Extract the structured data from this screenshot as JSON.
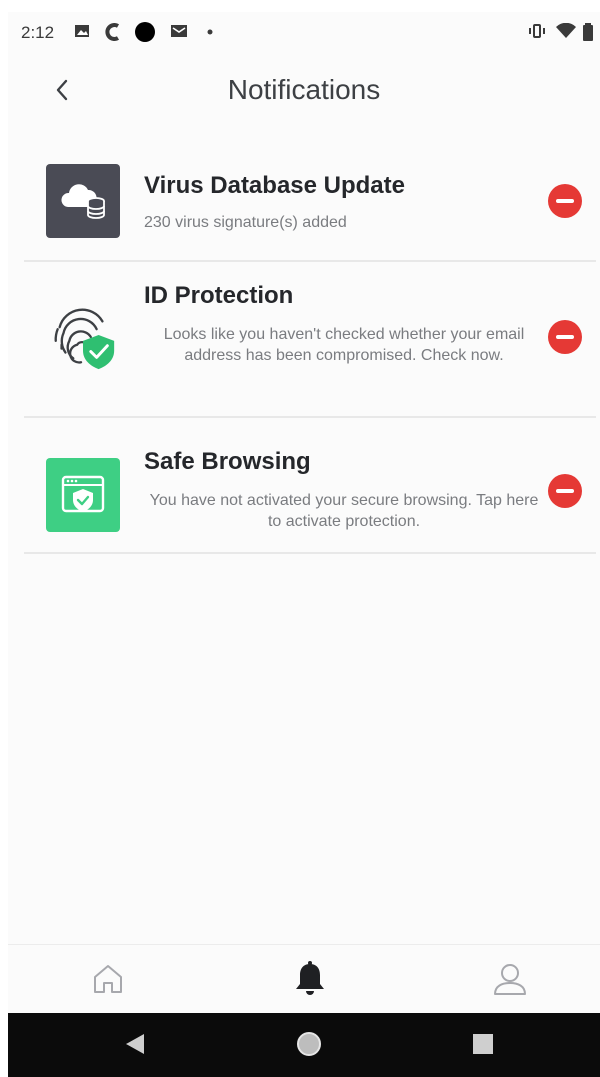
{
  "status_bar": {
    "time": "2:12",
    "icons": [
      "image-icon",
      "c-app-icon",
      "circle-icon",
      "mail-icon",
      "dot-icon",
      "vibrate-icon",
      "wifi-icon",
      "battery-icon"
    ]
  },
  "header": {
    "title": "Notifications",
    "back_icon": "chevron-left-icon"
  },
  "notifications": [
    {
      "title": "Virus Database Update",
      "description": "230 virus signature(s) added",
      "icon": "cloud-database-icon",
      "icon_bg": "#4a4b55"
    },
    {
      "title": "ID Protection",
      "description": "Looks like you haven't checked whether your email address has been compromised. Check now.",
      "icon": "fingerprint-shield-icon",
      "icon_bg": "#ffffff"
    },
    {
      "title": "Safe Browsing",
      "description": "You have not activated your secure browsing. Tap here to activate protection.",
      "icon": "browser-shield-icon",
      "icon_bg": "#3ecf84"
    }
  ],
  "bottom_nav": {
    "items": [
      "home-icon",
      "bell-icon",
      "profile-icon"
    ],
    "active": "bell-icon"
  },
  "colors": {
    "remove": "#e53935",
    "accent_green": "#2fbf71",
    "title_text": "#25272b",
    "body_text": "#7a7c80"
  }
}
